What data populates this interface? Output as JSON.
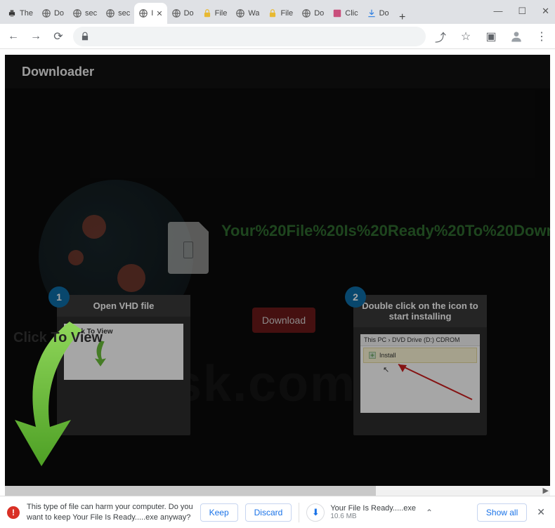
{
  "window": {
    "min": "—",
    "max": "☐",
    "close": "✕"
  },
  "tabs": [
    {
      "label": "The",
      "fav": "printer"
    },
    {
      "label": "Do",
      "fav": "globe"
    },
    {
      "label": "sec",
      "fav": "globe"
    },
    {
      "label": "sec",
      "fav": "globe"
    },
    {
      "label": "I",
      "fav": "globe",
      "active": true
    },
    {
      "label": "Do",
      "fav": "globe"
    },
    {
      "label": "File",
      "fav": "lock"
    },
    {
      "label": "Wa",
      "fav": "globe"
    },
    {
      "label": "File",
      "fav": "lock"
    },
    {
      "label": "Do",
      "fav": "globe"
    },
    {
      "label": "Clic",
      "fav": "dl"
    },
    {
      "label": "Do",
      "fav": "dl2"
    }
  ],
  "newtab": "+",
  "toolbar": {
    "back": "←",
    "fwd": "→",
    "reload": "⟳",
    "share": "⤴",
    "star": "☆",
    "ext": "▣",
    "user": "◯",
    "menu": "⋮"
  },
  "page": {
    "banner": "Downloader",
    "headline": "Your%20File%20Is%20Ready%20To%20Down",
    "download_btn": "Download",
    "click_to_view": "Click To View",
    "step1": {
      "num": "1",
      "title": "Open VHD file",
      "ctv": "Click To View"
    },
    "step2": {
      "num": "2",
      "title": "Double click on the icon to start installing",
      "breadcrumb_a": "This PC",
      "breadcrumb_b": "DVD Drive (D:) CDROM",
      "install": "Install"
    },
    "watermark": "sk.com"
  },
  "dlbar": {
    "warn1": "This type of file can harm your computer. Do you",
    "warn2": "want to keep Your File Is Ready.....exe anyway?",
    "keep": "Keep",
    "discard": "Discard",
    "filename": "Your File Is Ready.....exe",
    "size": "10.6 MB",
    "showall": "Show all"
  }
}
